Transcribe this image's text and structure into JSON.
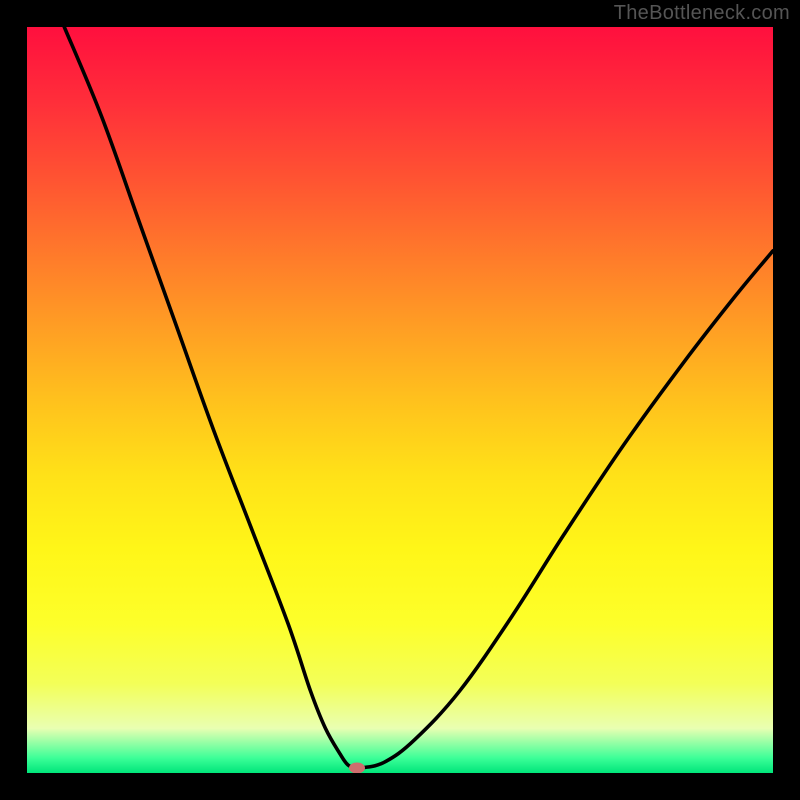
{
  "watermark": "TheBottleneck.com",
  "chart_data": {
    "type": "line",
    "title": "",
    "xlabel": "",
    "ylabel": "",
    "xlim": [
      0,
      100
    ],
    "ylim": [
      0,
      100
    ],
    "series": [
      {
        "name": "bottleneck-curve",
        "x": [
          5,
          10,
          15,
          20,
          25,
          30,
          35,
          38,
          40,
          42,
          43,
          44,
          45,
          48,
          52,
          58,
          65,
          72,
          80,
          88,
          95,
          100
        ],
        "y": [
          100,
          88,
          74,
          60,
          46,
          33,
          20,
          11,
          6,
          2.5,
          1.1,
          0.7,
          0.7,
          1.5,
          4.5,
          11,
          21,
          32,
          44,
          55,
          64,
          70
        ]
      }
    ],
    "marker": {
      "x": 44.2,
      "y": 0.7,
      "label": "optimal-point"
    },
    "gradient_colors": {
      "top": "#ff0f3e",
      "mid": "#ffe118",
      "bottom": "#00e57a"
    }
  }
}
